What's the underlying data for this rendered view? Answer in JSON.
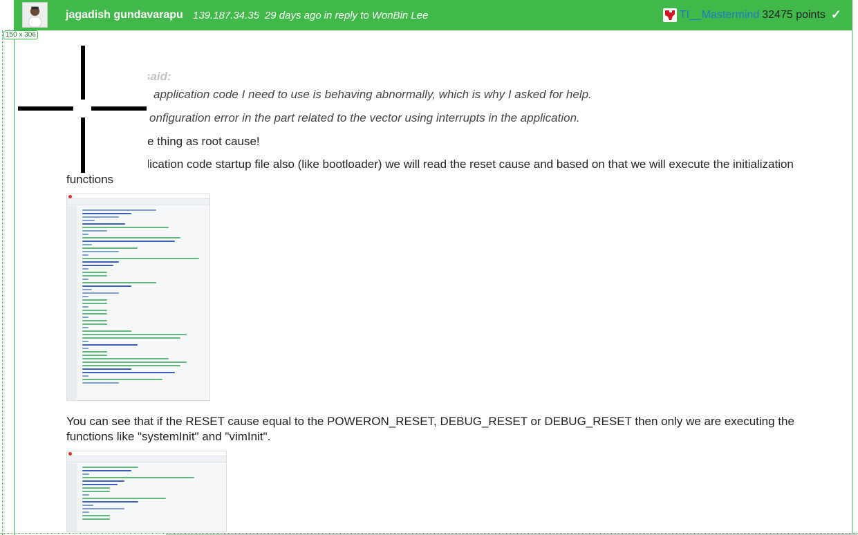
{
  "post": {
    "author": "jagadish gundavarapu",
    "ip": "139.187.34.35",
    "time": "29 days ago",
    "reply_prefix": "in reply to",
    "reply_to": "WonBin Lee",
    "badge": {
      "name": "TI__Mastermind",
      "points": "32475 points",
      "verified_icon": "checkmark-icon"
    },
    "avatar_icon": "user-avatar"
  },
  "overlay": {
    "size_tag": "150 x 306"
  },
  "body": {
    "quote_said": "said:",
    "quote_line1": "application code I need to use is behaving abnormally, which is why I asked for help.",
    "quote_line2": "onfiguration error in the part related to the vector using interrupts in the application.",
    "para1": "g one thing as root cause!",
    "para2": "application code startup file also (like bootloader) we will read the reset cause and based on that we will execute the initialization functions",
    "para3": "You can see that if the RESET cause equal to the POWERON_RESET, DEBUG_RESET or DEBUG_RESET then only we are executing the functions like \"systemInit\" and \"vimInit\"."
  },
  "colors": {
    "header_bg": "#40b84a",
    "link": "#1f7ac4",
    "border": "#3cb84a"
  }
}
